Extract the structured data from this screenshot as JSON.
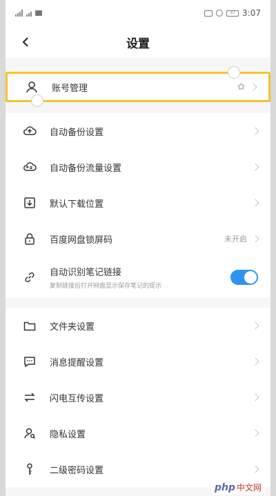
{
  "status_bar": {
    "time": "3:07",
    "battery": "37"
  },
  "header": {
    "title": "设置"
  },
  "account": {
    "label": "账号管理"
  },
  "rows": [
    {
      "label": "自动备份设置"
    },
    {
      "label": "自动备份流量设置"
    },
    {
      "label": "默认下载位置"
    },
    {
      "label": "百度网盘锁屏码",
      "value": "未开启"
    },
    {
      "label": "自动识别笔记链接",
      "sub": "复制链接后打开网盘显示保存笔记的提示",
      "toggle": true
    },
    {
      "label": "文件夹设置"
    },
    {
      "label": "消息提醒设置"
    },
    {
      "label": "闪电互传设置"
    },
    {
      "label": "隐私设置"
    },
    {
      "label": "二级密码设置"
    }
  ],
  "watermark": {
    "php": "php",
    "cn": "中文网"
  },
  "colors": {
    "accent_blue": "#2e94f0",
    "highlight_yellow": "#f5c32c"
  }
}
